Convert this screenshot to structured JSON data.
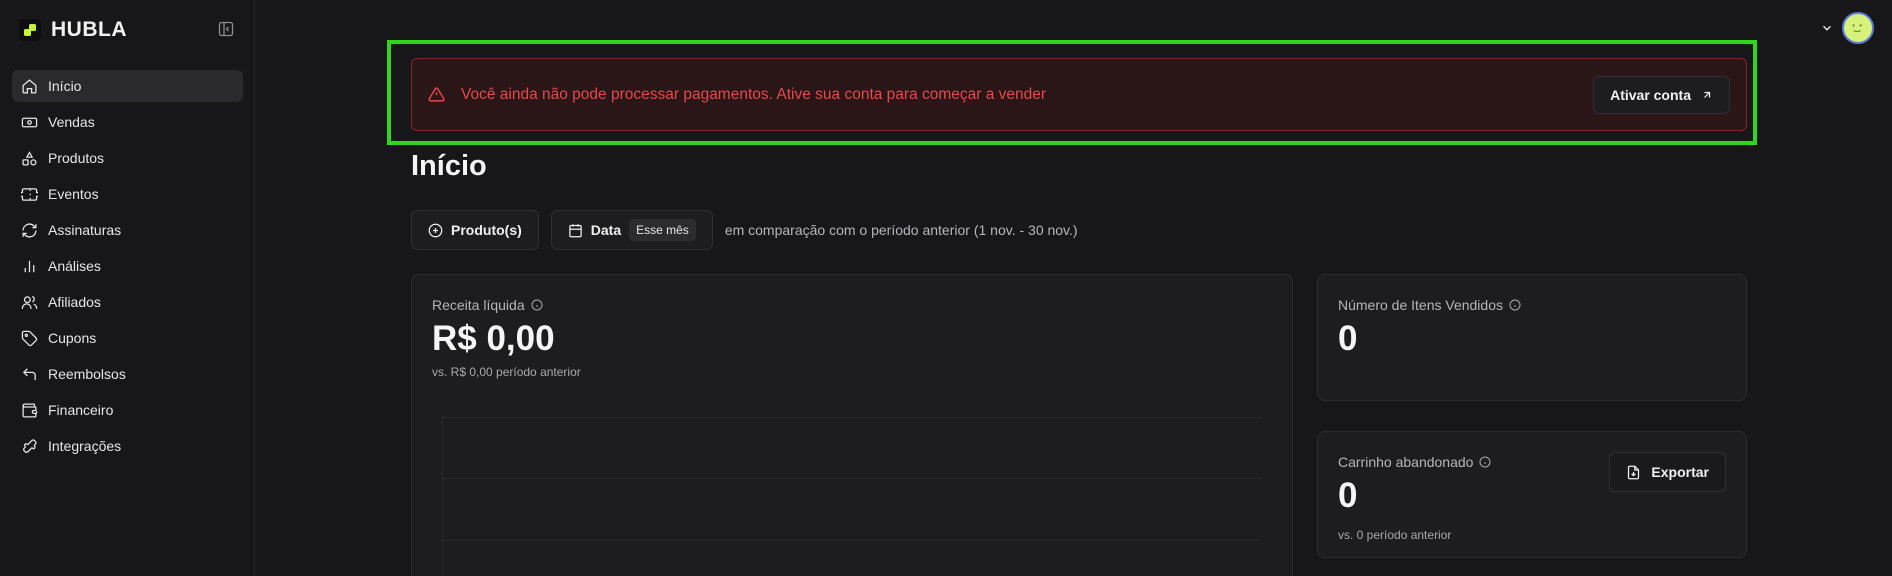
{
  "brand": {
    "name": "HUBLA"
  },
  "sidebar": {
    "items": [
      {
        "label": "Início",
        "icon": "home-icon"
      },
      {
        "label": "Vendas",
        "icon": "banknote-icon"
      },
      {
        "label": "Produtos",
        "icon": "shapes-icon"
      },
      {
        "label": "Eventos",
        "icon": "ticket-icon"
      },
      {
        "label": "Assinaturas",
        "icon": "refresh-icon"
      },
      {
        "label": "Análises",
        "icon": "bar-chart-icon"
      },
      {
        "label": "Afiliados",
        "icon": "users-icon"
      },
      {
        "label": "Cupons",
        "icon": "tag-icon"
      },
      {
        "label": "Reembolsos",
        "icon": "undo-icon"
      },
      {
        "label": "Financeiro",
        "icon": "wallet-icon"
      },
      {
        "label": "Integrações",
        "icon": "puzzle-icon"
      }
    ]
  },
  "alert": {
    "message": "Você ainda não pode processar pagamentos. Ative sua conta para começar a vender",
    "button_label": "Ativar conta"
  },
  "page": {
    "title": "Início"
  },
  "filters": {
    "product_label": "Produto(s)",
    "date_label": "Data",
    "date_value": "Esse mês",
    "comparison_text": "em comparação com o período anterior (1 nov. - 30 nov.)"
  },
  "cards": {
    "revenue": {
      "label": "Receita líquida",
      "value": "R$ 0,00",
      "sub": "vs. R$ 0,00 período anterior"
    },
    "items_sold": {
      "label": "Número de Itens Vendidos",
      "value": "0"
    },
    "abandoned_cart": {
      "label": "Carrinho abandonado",
      "value": "0",
      "sub": "vs. 0 período anterior",
      "export_label": "Exportar"
    }
  },
  "colors": {
    "accent_green": "#33d41f",
    "alert_red": "#e5484d",
    "brand_lime": "#c6f33a"
  }
}
